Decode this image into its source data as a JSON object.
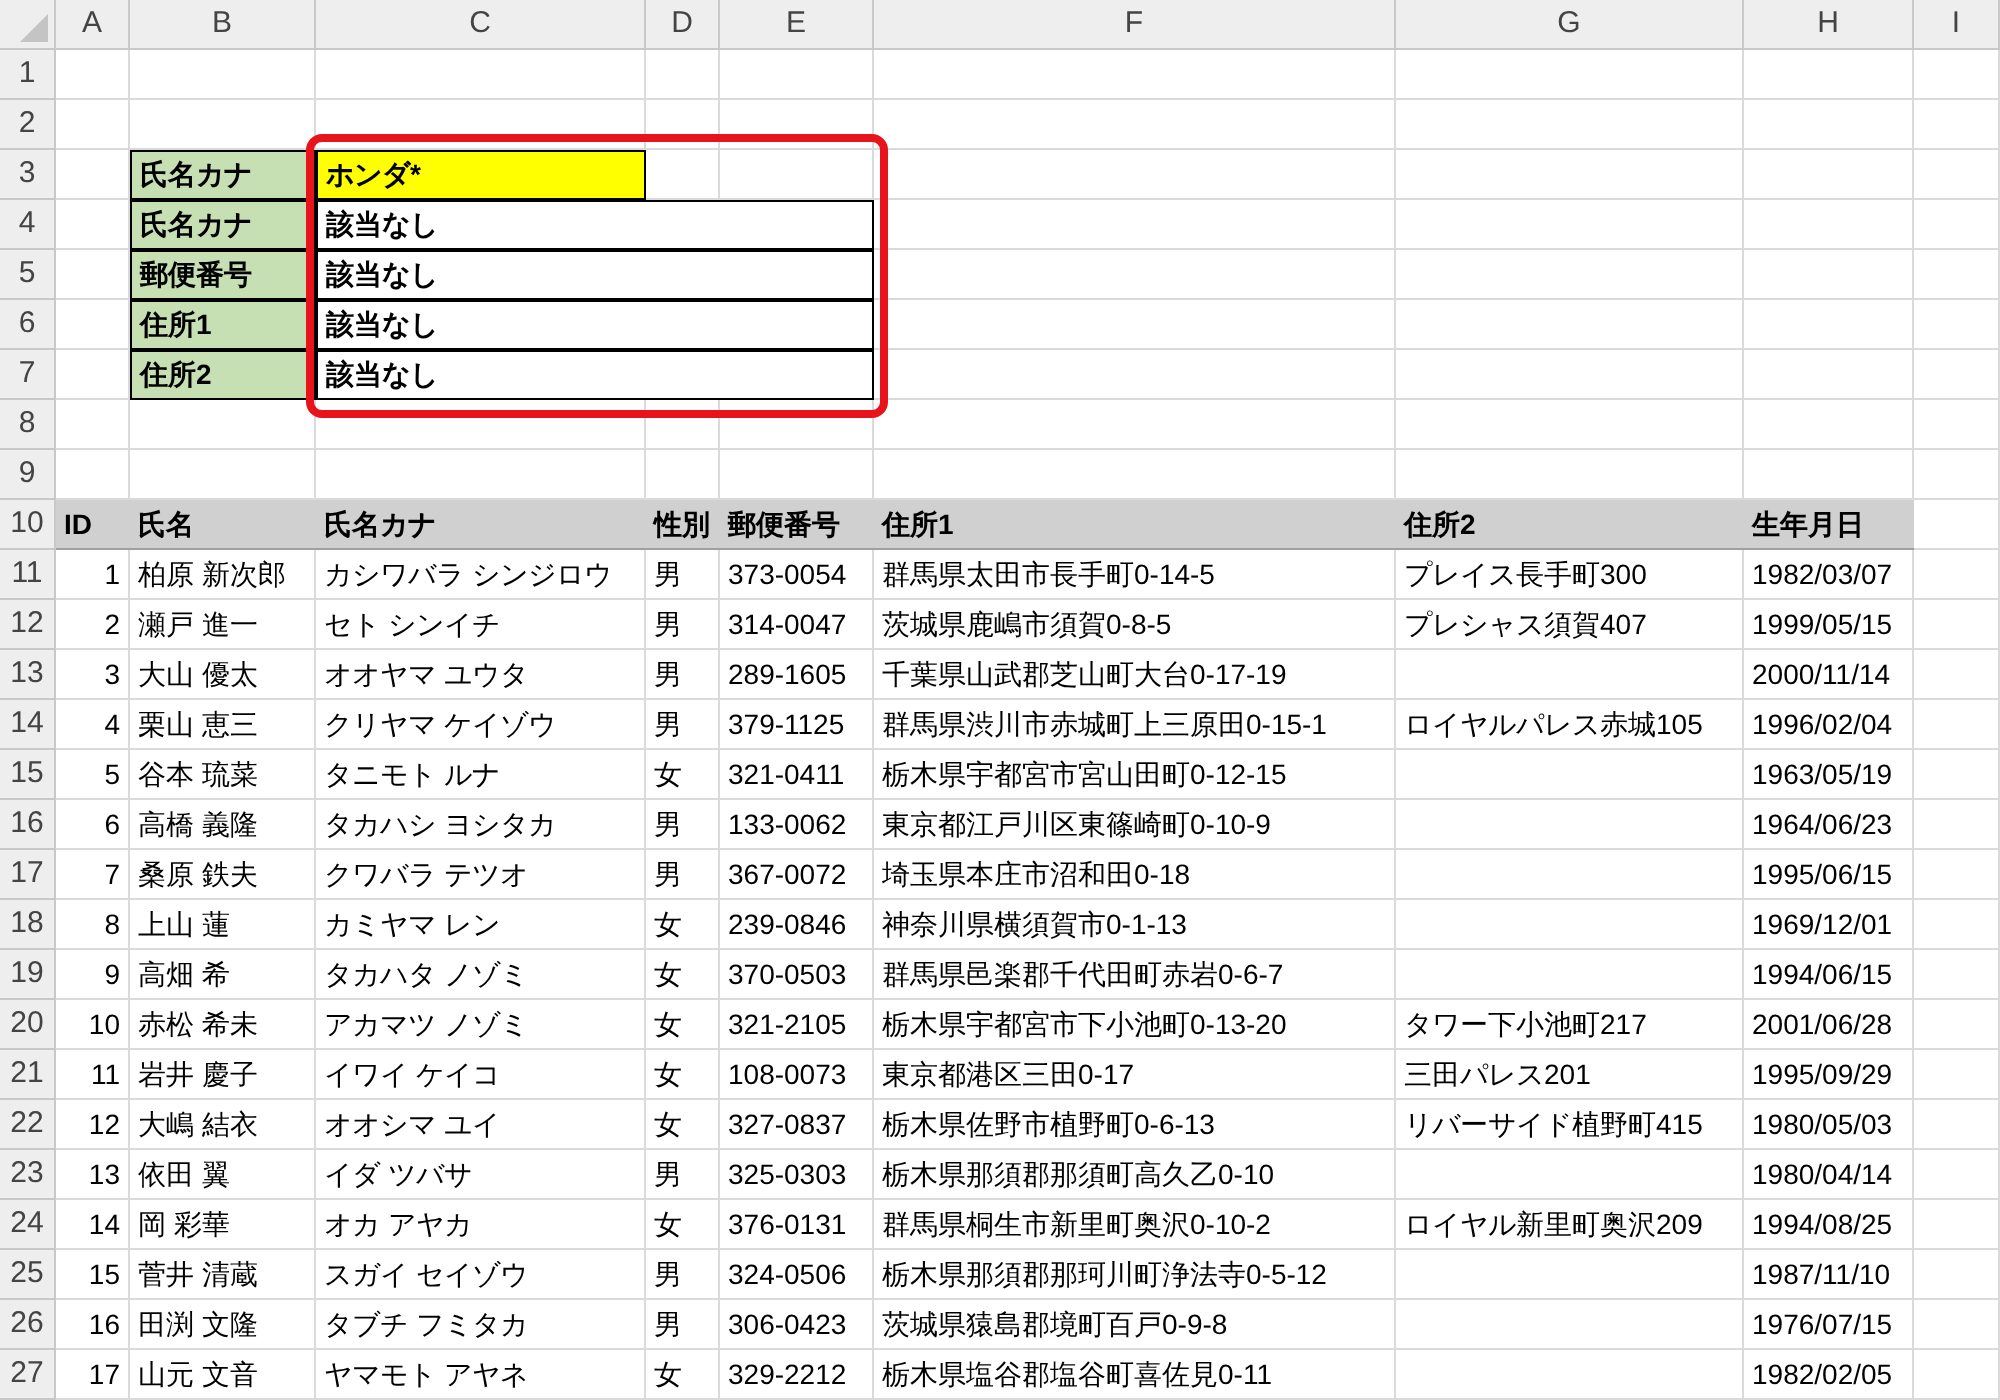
{
  "column_headers": [
    "A",
    "B",
    "C",
    "D",
    "E",
    "F",
    "G",
    "H",
    "I"
  ],
  "row_numbers": [
    "1",
    "2",
    "3",
    "4",
    "5",
    "6",
    "7",
    "8",
    "9",
    "10",
    "11",
    "12",
    "13",
    "14",
    "15",
    "16",
    "17",
    "18",
    "19",
    "20",
    "21",
    "22",
    "23",
    "24",
    "25",
    "26",
    "27"
  ],
  "lookup": [
    {
      "label": "氏名カナ",
      "value": "ホンダ*",
      "kind": "input"
    },
    {
      "label": "氏名カナ",
      "value": "該当なし",
      "kind": "result"
    },
    {
      "label": "郵便番号",
      "value": "該当なし",
      "kind": "result"
    },
    {
      "label": "住所1",
      "value": "該当なし",
      "kind": "result"
    },
    {
      "label": "住所2",
      "value": "該当なし",
      "kind": "result"
    }
  ],
  "table": {
    "columns": [
      "ID",
      "氏名",
      "氏名カナ",
      "性別",
      "郵便番号",
      "住所1",
      "住所2",
      "生年月日"
    ],
    "rows": [
      {
        "id": "1",
        "name": "柏原 新次郎",
        "kana": "カシワバラ シンジロウ",
        "gender": "男",
        "postal_code": "373-0054",
        "address1": "群馬県太田市長手町0-14-5",
        "address2": "プレイス長手町300",
        "birth_date": "1982/03/07"
      },
      {
        "id": "2",
        "name": "瀬戸 進一",
        "kana": "セト シンイチ",
        "gender": "男",
        "postal_code": "314-0047",
        "address1": "茨城県鹿嶋市須賀0-8-5",
        "address2": "プレシャス須賀407",
        "birth_date": "1999/05/15"
      },
      {
        "id": "3",
        "name": "大山 優太",
        "kana": "オオヤマ ユウタ",
        "gender": "男",
        "postal_code": "289-1605",
        "address1": "千葉県山武郡芝山町大台0-17-19",
        "birth_date": "2000/11/14"
      },
      {
        "id": "4",
        "name": "栗山 恵三",
        "kana": "クリヤマ ケイゾウ",
        "gender": "男",
        "postal_code": "379-1125",
        "address1": "群馬県渋川市赤城町上三原田0-15-1",
        "address2": "ロイヤルパレス赤城105",
        "birth_date": "1996/02/04"
      },
      {
        "id": "5",
        "name": "谷本 琉菜",
        "kana": "タニモト ルナ",
        "gender": "女",
        "postal_code": "321-0411",
        "address1": "栃木県宇都宮市宮山田町0-12-15",
        "birth_date": "1963/05/19"
      },
      {
        "id": "6",
        "name": "高橋 義隆",
        "kana": "タカハシ ヨシタカ",
        "gender": "男",
        "postal_code": "133-0062",
        "address1": "東京都江戸川区東篠崎町0-10-9",
        "birth_date": "1964/06/23"
      },
      {
        "id": "7",
        "name": "桑原 鉄夫",
        "kana": "クワバラ テツオ",
        "gender": "男",
        "postal_code": "367-0072",
        "address1": "埼玉県本庄市沼和田0-18",
        "birth_date": "1995/06/15"
      },
      {
        "id": "8",
        "name": "上山 蓮",
        "kana": "カミヤマ レン",
        "gender": "女",
        "postal_code": "239-0846",
        "address1": "神奈川県横須賀市0-1-13",
        "birth_date": "1969/12/01"
      },
      {
        "id": "9",
        "name": "高畑 希",
        "kana": "タカハタ ノゾミ",
        "gender": "女",
        "postal_code": "370-0503",
        "address1": "群馬県邑楽郡千代田町赤岩0-6-7",
        "birth_date": "1994/06/15"
      },
      {
        "id": "10",
        "name": "赤松 希未",
        "kana": "アカマツ ノゾミ",
        "gender": "女",
        "postal_code": "321-2105",
        "address1": "栃木県宇都宮市下小池町0-13-20",
        "address2": "タワー下小池町217",
        "birth_date": "2001/06/28"
      },
      {
        "id": "11",
        "name": "岩井 慶子",
        "kana": "イワイ ケイコ",
        "gender": "女",
        "postal_code": "108-0073",
        "address1": "東京都港区三田0-17",
        "address2": "三田パレス201",
        "birth_date": "1995/09/29"
      },
      {
        "id": "12",
        "name": "大嶋 結衣",
        "kana": "オオシマ ユイ",
        "gender": "女",
        "postal_code": "327-0837",
        "address1": "栃木県佐野市植野町0-6-13",
        "address2": "リバーサイド植野町415",
        "birth_date": "1980/05/03"
      },
      {
        "id": "13",
        "name": "依田 翼",
        "kana": "イダ ツバサ",
        "gender": "男",
        "postal_code": "325-0303",
        "address1": "栃木県那須郡那須町高久乙0-10",
        "birth_date": "1980/04/14"
      },
      {
        "id": "14",
        "name": "岡 彩華",
        "kana": "オカ アヤカ",
        "gender": "女",
        "postal_code": "376-0131",
        "address1": "群馬県桐生市新里町奥沢0-10-2",
        "address2": "ロイヤル新里町奥沢209",
        "birth_date": "1994/08/25"
      },
      {
        "id": "15",
        "name": "菅井 清蔵",
        "kana": "スガイ セイゾウ",
        "gender": "男",
        "postal_code": "324-0506",
        "address1": "栃木県那須郡那珂川町浄法寺0-5-12",
        "birth_date": "1987/11/10"
      },
      {
        "id": "16",
        "name": "田渕 文隆",
        "kana": "タブチ フミタカ",
        "gender": "男",
        "postal_code": "306-0423",
        "address1": "茨城県猿島郡境町百戸0-9-8",
        "birth_date": "1976/07/15"
      },
      {
        "id": "17",
        "name": "山元 文音",
        "kana": "ヤマモト アヤネ",
        "gender": "女",
        "postal_code": "329-2212",
        "address1": "栃木県塩谷郡塩谷町喜佐見0-11",
        "birth_date": "1982/02/05"
      }
    ]
  }
}
